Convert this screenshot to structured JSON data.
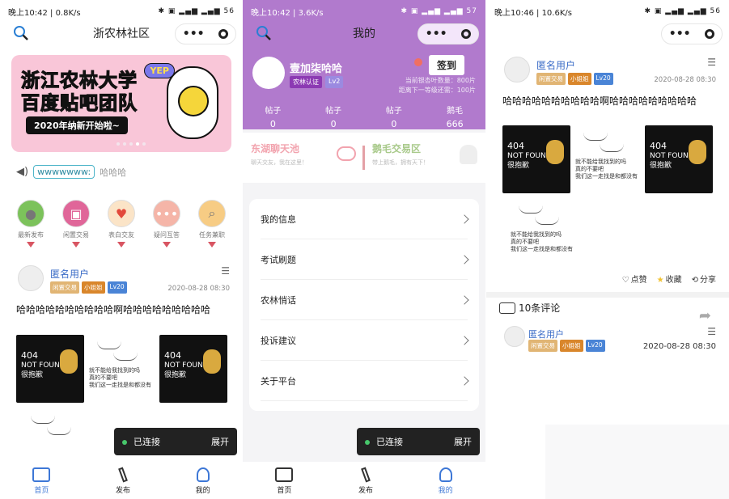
{
  "screen1": {
    "status": {
      "time": "晚上10:42",
      "speed": "0.8K/s",
      "battery": "56"
    },
    "title": "浙农林社区",
    "banner": {
      "title": "浙江农林大学\n百度贴吧团队",
      "subtitle": "2020年纳新开始啦~",
      "badge": "YEP"
    },
    "notice": {
      "label": "wwwwwww:",
      "text": "哈哈哈"
    },
    "categories": [
      {
        "label": "最新发布",
        "icon": "avatar-icon",
        "color": "#7cc25b"
      },
      {
        "label": "闲置交易",
        "icon": "bag-icon",
        "color": "#e06699"
      },
      {
        "label": "表白交友",
        "icon": "heart-icon",
        "color": "#f7d28f"
      },
      {
        "label": "疑问互答",
        "icon": "chat-icon",
        "color": "#f5b5a8"
      },
      {
        "label": "任务兼职",
        "icon": "search-icon",
        "color": "#f7cc84"
      }
    ],
    "post": {
      "user": "匿名用户",
      "tags": [
        "闲置交易",
        "小姐姐",
        "Lv20"
      ],
      "date": "2020-08-28 08:30",
      "body": "哈哈哈哈哈哈哈哈哈哈啊哈哈哈哈哈哈哈哈哈"
    },
    "toast": {
      "text": "已连接",
      "action": "展开"
    },
    "tabs": [
      "首页",
      "发布",
      "我的"
    ]
  },
  "screen2": {
    "status": {
      "time": "晚上10:42",
      "speed": "3.6K/s",
      "battery": "57"
    },
    "title": "我的",
    "profile": {
      "name": "壹加柒哈哈",
      "tags": [
        "农林认证",
        "Lv2"
      ],
      "sign": "签到",
      "line1": "当前银杏叶数量：800片",
      "line2": "距离下一等级还需：100片"
    },
    "stats": [
      {
        "label": "帖子",
        "value": "0"
      },
      {
        "label": "帖子",
        "value": "0"
      },
      {
        "label": "帖子",
        "value": "0"
      },
      {
        "label": "鹅毛",
        "value": "666"
      }
    ],
    "cards": [
      {
        "title": "东湖聊天池",
        "sub": "聊天交友，我在这里！"
      },
      {
        "title": "鹅毛交易区",
        "sub": "带上鹅毛，拥有天下！"
      }
    ],
    "menu": [
      "我的信息",
      "考试刷题",
      "农林悄话",
      "投诉建议",
      "关于平台"
    ],
    "toast": {
      "text": "已连接",
      "action": "展开"
    },
    "tabs": [
      "首页",
      "发布",
      "我的"
    ]
  },
  "screen3": {
    "status": {
      "time": "晚上10:46",
      "speed": "10.6K/s",
      "battery": "56"
    },
    "post": {
      "user": "匿名用户",
      "tags": [
        "闲置交易",
        "小姐姐",
        "Lv20"
      ],
      "date": "2020-08-28 08:30",
      "body": "哈哈哈哈哈哈哈哈哈哈啊哈哈哈哈哈哈哈哈哈"
    },
    "actions": [
      "点赞",
      "收藏",
      "分享"
    ],
    "comments_title": "10条评论",
    "comment": {
      "user": "匿名用户",
      "tags": [
        "闲置交易",
        "小姐姐",
        "Lv20"
      ],
      "date": "2020-08-28 08:30"
    }
  },
  "image_text": {
    "line1": "404",
    "line2": "NOT FOUND",
    "line3": "很抱歉",
    "sketch": "就不能给我找到的吗\n真的不要吧\n我们这一走找是和都没有"
  }
}
